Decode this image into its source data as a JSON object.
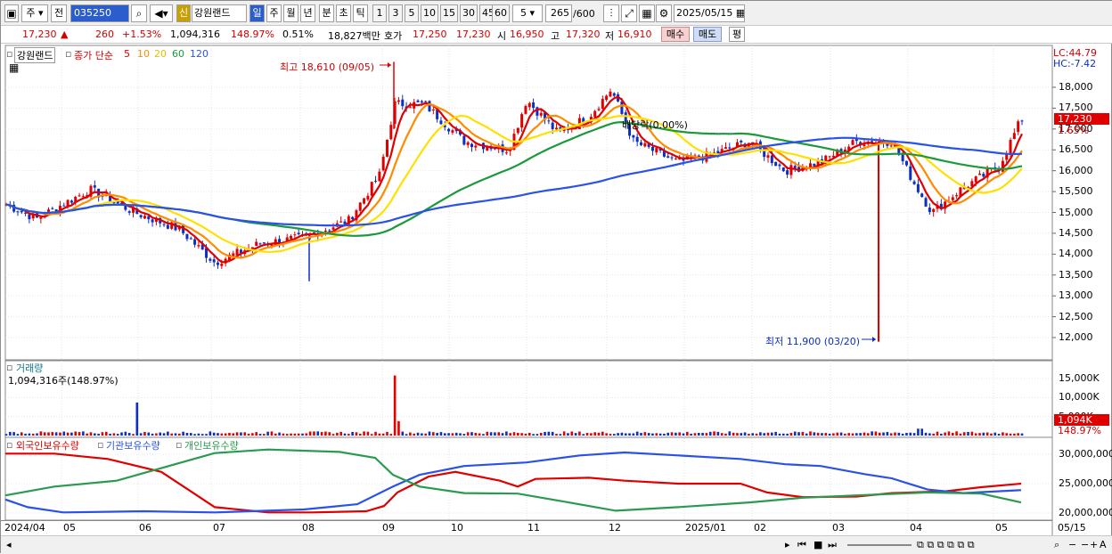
{
  "toolbar": {
    "market": "주",
    "prev": "전",
    "code": "035250",
    "sin": "신",
    "name": "강원랜드",
    "periods": [
      "일",
      "주",
      "월",
      "년",
      "분",
      "초",
      "틱"
    ],
    "intervals": [
      "1",
      "3",
      "5",
      "10",
      "15",
      "30",
      "45",
      "60"
    ],
    "count_value": "5",
    "range": "265",
    "range_max": "/600",
    "date": "2025/05/15"
  },
  "quote": {
    "price": "17,230",
    "change": "260",
    "change_pct": "+1.53%",
    "volume": "1,094,316",
    "volume_ratio": "148.97%",
    "turnover": "0.51%",
    "amount": "18,827백만",
    "bid_label": "호가",
    "bid1": "17,250",
    "bid2": "17,230",
    "open_label": "시",
    "open": "16,950",
    "high_label": "고",
    "high": "17,320",
    "low_label": "저",
    "low": "16,910",
    "buy": "매수",
    "sell": "매도",
    "avg": "평"
  },
  "price_panel": {
    "name": "강원랜드",
    "legend_label": "종가 단순",
    "ma": [
      "5",
      "10",
      "20",
      "60",
      "120"
    ],
    "ma_colors": [
      "#e00000",
      "#ff8c00",
      "#ffe000",
      "#1a9a3a",
      "#2a52e6"
    ],
    "lc": "LC:44.79",
    "hc": "HC:-7.42",
    "high_note": "최고 18,610 (09/05)",
    "low_note": "최저 11,900 (03/20)",
    "div_note": "배당락(0.00%)",
    "yticks": [
      "18,000",
      "17,500",
      "17,000",
      "16,500",
      "16,000",
      "15,500",
      "15,000",
      "14,500",
      "14,000",
      "13,500",
      "13,000",
      "12,500",
      "12,000"
    ],
    "last": "17,230",
    "last_pct": "1.65%"
  },
  "volume_panel": {
    "title": "거래량",
    "value": "1,094,316주(148.97%)",
    "yticks": [
      "15,000K",
      "10,000K",
      "5,000K"
    ],
    "last": "1,094K",
    "last_pct": "148.97%"
  },
  "holding_panel": {
    "labels": [
      "외국인보유수량",
      "기관보유수량",
      "개인보유수량"
    ],
    "colors": [
      "#e00000",
      "#2a52e6",
      "#2a9a50"
    ],
    "yticks": [
      "30,000,000",
      "25,000,000",
      "20,000,000"
    ]
  },
  "xaxis": [
    "2024/04",
    "05",
    "06",
    "07",
    "08",
    "09",
    "10",
    "11",
    "12",
    "2025/01",
    "02",
    "03",
    "04",
    "05",
    "05/15"
  ],
  "chart_data": {
    "type": "line",
    "title": "강원랜드",
    "ylim": [
      11700,
      18600
    ],
    "ma_periods": [
      5,
      10,
      20,
      60,
      120
    ],
    "annotations": [
      "최고 18,610 (09/05)",
      "최저 11,900 (03/20)"
    ]
  }
}
